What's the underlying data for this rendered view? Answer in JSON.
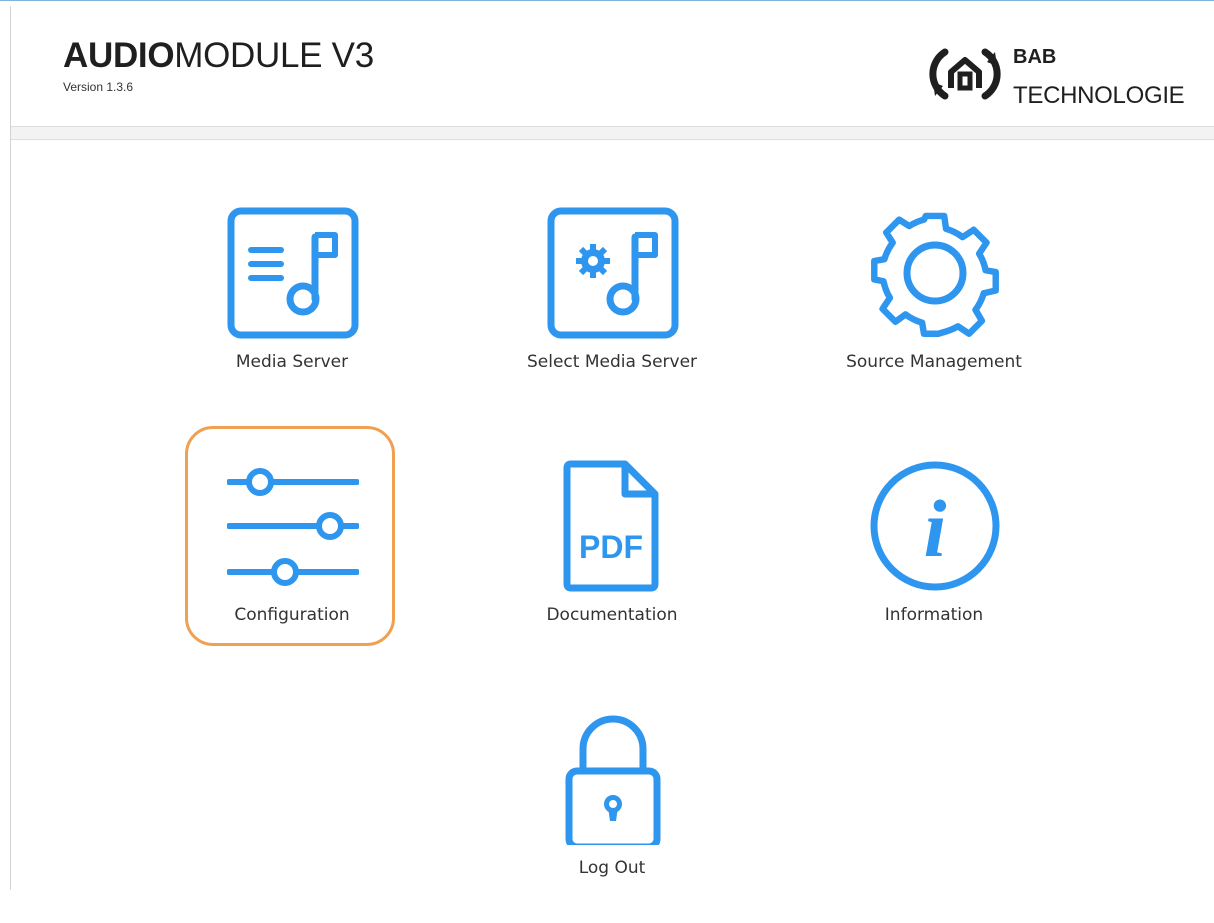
{
  "header": {
    "title_bold": "AUDIO",
    "title_light": "MODULE V3",
    "version": "Version 1.3.6",
    "brand_line1": "BAB",
    "brand_line2": "TECHNOLOGIE"
  },
  "menu": {
    "media_server": {
      "label": "Media Server",
      "icon": "music-list-icon"
    },
    "select_media_server": {
      "label": "Select Media Server",
      "icon": "music-gear-icon"
    },
    "source_management": {
      "label": "Source Management",
      "icon": "gear-icon"
    },
    "configuration": {
      "label": "Configuration",
      "icon": "sliders-icon",
      "selected": true
    },
    "documentation": {
      "label": "Documentation",
      "icon": "pdf-file-icon",
      "icon_text": "PDF"
    },
    "information": {
      "label": "Information",
      "icon": "info-icon",
      "icon_text": "i"
    },
    "log_out": {
      "label": "Log Out",
      "icon": "lock-icon"
    }
  },
  "colors": {
    "icon_blue": "#2e96ee",
    "highlight_orange": "#f0a050",
    "text": "#333333"
  }
}
